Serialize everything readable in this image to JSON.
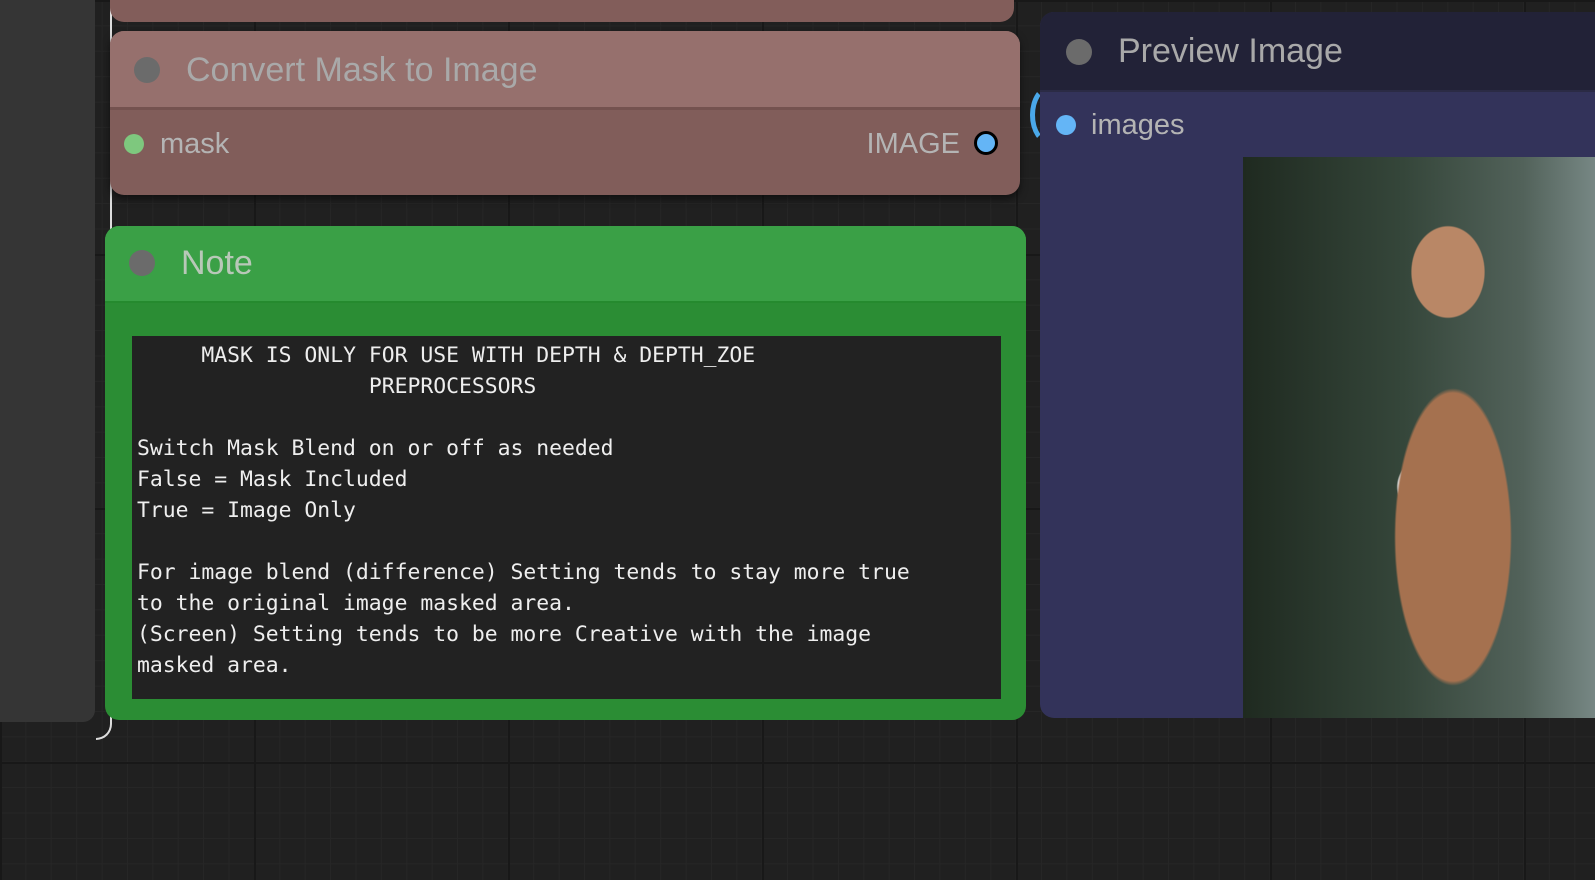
{
  "convert_node": {
    "title": "Convert Mask to Image",
    "input_label": "mask",
    "output_label": "IMAGE"
  },
  "note_node": {
    "title": "Note",
    "text": "     MASK IS ONLY FOR USE WITH DEPTH & DEPTH_ZOE\n                  PREPROCESSORS\n\nSwitch Mask Blend on or off as needed\nFalse = Mask Included\nTrue = Image Only\n\nFor image blend (difference) Setting tends to stay more true\nto the original image masked area.\n(Screen) Setting tends to be more Creative with the image\nmasked area."
  },
  "preview_node": {
    "title": "Preview Image",
    "input_label": "images"
  },
  "colors": {
    "mask_slot": "#7ec87e",
    "image_slot": "#64b5f6",
    "link": "#4aa8e8",
    "note_bg": "#2b8d34",
    "convert_bg": "#815d5a",
    "preview_bg": "#33335a"
  }
}
